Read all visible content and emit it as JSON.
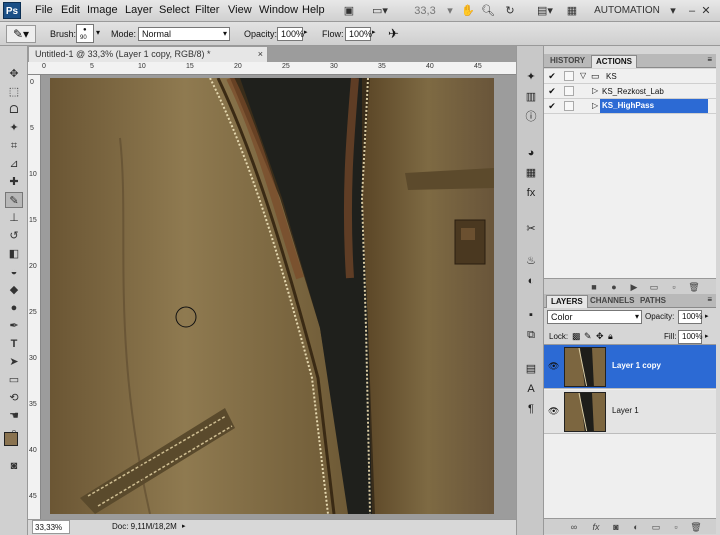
{
  "app": {
    "logo": "Ps"
  },
  "menu": [
    "File",
    "Edit",
    "Image",
    "Layer",
    "Select",
    "Filter",
    "View",
    "Window",
    "Help"
  ],
  "toolbar": {
    "zoom": "33,3",
    "workspace": "AUTOMATION"
  },
  "options": {
    "brush_label": "Brush:",
    "brush_size": "90",
    "mode_label": "Mode:",
    "mode_value": "Normal",
    "opacity_label": "Opacity:",
    "opacity_value": "100%",
    "flow_label": "Flow:",
    "flow_value": "100%"
  },
  "document": {
    "tab_title": "Untitled-1 @ 33,3% (Layer 1 copy, RGB/8) *",
    "ruler_top": [
      "0",
      "5",
      "10",
      "15",
      "20",
      "25",
      "30",
      "35",
      "40",
      "45"
    ],
    "ruler_left": [
      "0",
      "5",
      "10",
      "15",
      "20",
      "25",
      "30",
      "35",
      "40",
      "45"
    ]
  },
  "status": {
    "zoom": "33,33%",
    "doc": "Doc: 9,11M/18,2M"
  },
  "history_panel": {
    "tabs": [
      "HISTORY",
      "ACTIONS"
    ],
    "active_tab": "ACTIONS",
    "items": [
      {
        "name": "KS",
        "checked": true,
        "selected": false
      },
      {
        "name": "KS_Rezkost_Lab",
        "checked": true,
        "selected": false
      },
      {
        "name": "KS_HighPass",
        "checked": true,
        "selected": true
      }
    ]
  },
  "layers_panel": {
    "tabs": [
      "LAYERS",
      "CHANNELS",
      "PATHS"
    ],
    "active_tab": "LAYERS",
    "blend_mode": "Color",
    "opacity_label": "Opacity:",
    "opacity_value": "100%",
    "lock_label": "Lock:",
    "fill_label": "Fill:",
    "fill_value": "100%",
    "layers": [
      {
        "name": "Layer 1 copy",
        "selected": true
      },
      {
        "name": "Layer 1",
        "selected": false
      }
    ]
  },
  "colors": {
    "accent": "#2c6ad4",
    "foreground": "#8a7350",
    "background": "#ffffff"
  }
}
